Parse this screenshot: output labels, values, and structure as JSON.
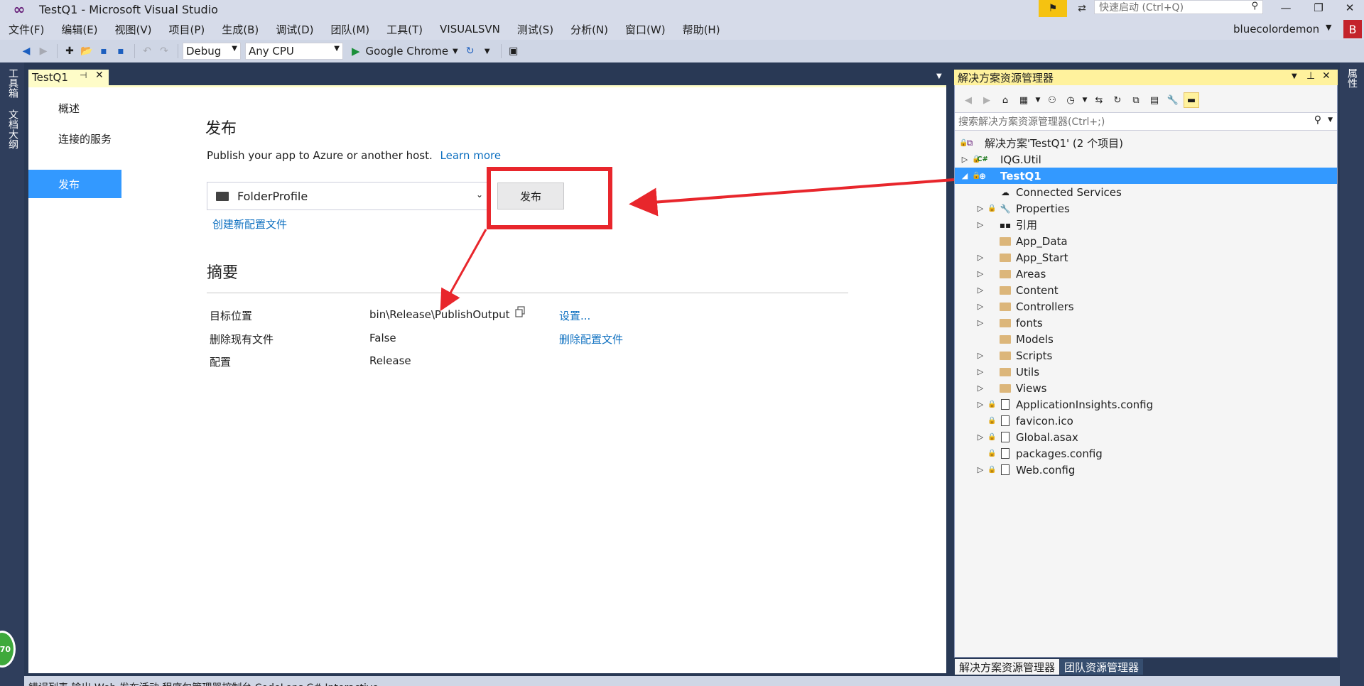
{
  "window": {
    "title": "TestQ1 - Microsoft Visual Studio",
    "quick_launch_placeholder": "快速启动 (Ctrl+Q)"
  },
  "menu": [
    "文件(F)",
    "编辑(E)",
    "视图(V)",
    "项目(P)",
    "生成(B)",
    "调试(D)",
    "团队(M)",
    "工具(T)",
    "VISUALSVN",
    "测试(S)",
    "分析(N)",
    "窗口(W)",
    "帮助(H)"
  ],
  "user": {
    "name": "bluecolordemon",
    "initial": "B"
  },
  "toolbar": {
    "configuration": "Debug",
    "platform": "Any CPU",
    "run_target": "Google Chrome"
  },
  "left_strip": {
    "tab1": "工具箱",
    "tab2": "文档大纲",
    "badge": "70"
  },
  "right_strip": {
    "tab1": "属性"
  },
  "doc_tab": {
    "label": "TestQ1"
  },
  "nav": [
    "概述",
    "连接的服务",
    "发布"
  ],
  "publish": {
    "title": "发布",
    "description": "Publish your app to Azure or another host.",
    "learn_more": "Learn more",
    "profile": "FolderProfile",
    "publish_button": "发布",
    "create_profile": "创建新配置文件"
  },
  "summary": {
    "title": "摘要",
    "rows": [
      {
        "label": "目标位置",
        "value": "bin\\Release\\PublishOutput",
        "link": "设置..."
      },
      {
        "label": "删除现有文件",
        "value": "False",
        "link": "删除配置文件"
      },
      {
        "label": "配置",
        "value": "Release",
        "link": ""
      }
    ]
  },
  "solution_explorer": {
    "title": "解决方案资源管理器",
    "search_placeholder": "搜索解决方案资源管理器(Ctrl+;)",
    "tree": [
      {
        "label": "解决方案'TestQ1' (2 个项目)",
        "expander": "",
        "icon": "solution-icon"
      },
      {
        "label": "IQG.Util",
        "expander": "▷",
        "icon": "csharp-project-icon"
      },
      {
        "label": "TestQ1",
        "expander": "◢",
        "icon": "web-project-icon"
      },
      {
        "label": "Connected Services",
        "expander": "",
        "icon": "cloud-icon"
      },
      {
        "label": "Properties",
        "expander": "▷",
        "icon": "wrench-icon"
      },
      {
        "label": "引用",
        "expander": "▷",
        "icon": "references-icon"
      },
      {
        "label": "App_Data",
        "expander": "",
        "icon": "folder-icon"
      },
      {
        "label": "App_Start",
        "expander": "▷",
        "icon": "folder-icon"
      },
      {
        "label": "Areas",
        "expander": "▷",
        "icon": "folder-icon"
      },
      {
        "label": "Content",
        "expander": "▷",
        "icon": "folder-icon"
      },
      {
        "label": "Controllers",
        "expander": "▷",
        "icon": "folder-icon"
      },
      {
        "label": "fonts",
        "expander": "▷",
        "icon": "folder-icon"
      },
      {
        "label": "Models",
        "expander": "",
        "icon": "folder-icon"
      },
      {
        "label": "Scripts",
        "expander": "▷",
        "icon": "folder-icon"
      },
      {
        "label": "Utils",
        "expander": "▷",
        "icon": "folder-icon"
      },
      {
        "label": "Views",
        "expander": "▷",
        "icon": "folder-icon"
      },
      {
        "label": "ApplicationInsights.config",
        "expander": "▷",
        "icon": "config-file-icon"
      },
      {
        "label": "favicon.ico",
        "expander": "",
        "icon": "ico-file-icon"
      },
      {
        "label": "Global.asax",
        "expander": "▷",
        "icon": "asax-file-icon"
      },
      {
        "label": "packages.config",
        "expander": "",
        "icon": "config-file-icon"
      },
      {
        "label": "Web.config",
        "expander": "▷",
        "icon": "config-file-icon"
      }
    ],
    "bottom_tabs": [
      "解决方案资源管理器",
      "团队资源管理器"
    ]
  },
  "status_bar": "错误列表   输出   Web 发布活动   程序包管理器控制台   CodeLens   C# Interactive",
  "colors": {
    "accent": "#3399ff",
    "highlight_box": "#e8262c",
    "link": "#0e70c0"
  }
}
